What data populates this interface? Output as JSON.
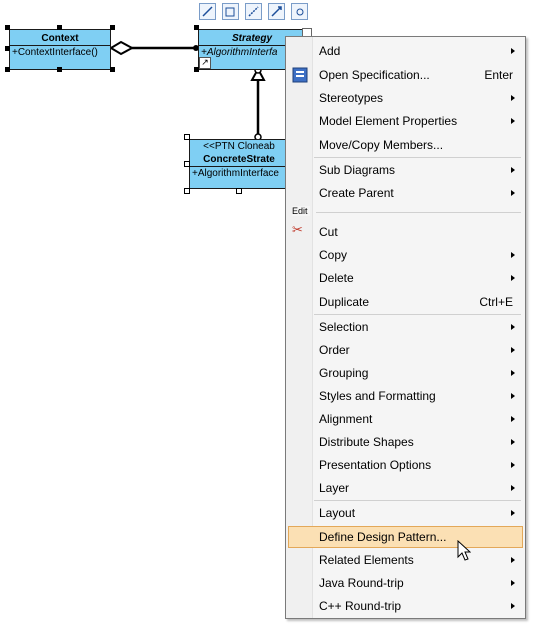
{
  "diagram": {
    "context_class": {
      "name": "Context",
      "operation": "+ContextInterface()"
    },
    "strategy_class": {
      "name": "Strategy",
      "operation": "+AlgorithmInterfa"
    },
    "concrete_class": {
      "stereotype": "<<PTN Cloneab",
      "name": "ConcreteStrate",
      "operation": "+AlgorithmInterface"
    }
  },
  "menu": {
    "edit_group_label": "Edit",
    "items": [
      {
        "label": "Add",
        "submenu": true
      },
      {
        "label": "Open Specification...",
        "shortcut": "Enter"
      },
      {
        "label": "Stereotypes",
        "submenu": true
      },
      {
        "label": "Model Element Properties",
        "submenu": true
      },
      {
        "label": "Move/Copy Members..."
      },
      {
        "label": "Sub Diagrams",
        "submenu": true
      },
      {
        "label": "Create Parent",
        "submenu": true
      },
      {
        "label": "Cut"
      },
      {
        "label": "Copy",
        "submenu": true
      },
      {
        "label": "Delete",
        "submenu": true
      },
      {
        "label": "Duplicate",
        "shortcut": "Ctrl+E"
      },
      {
        "label": "Selection",
        "submenu": true
      },
      {
        "label": "Order",
        "submenu": true
      },
      {
        "label": "Grouping",
        "submenu": true
      },
      {
        "label": "Styles and Formatting",
        "submenu": true
      },
      {
        "label": "Alignment",
        "submenu": true
      },
      {
        "label": "Distribute Shapes",
        "submenu": true
      },
      {
        "label": "Presentation Options",
        "submenu": true
      },
      {
        "label": "Layer",
        "submenu": true
      },
      {
        "label": "Layout",
        "submenu": true
      },
      {
        "label": "Define Design Pattern...",
        "highlighted": true
      },
      {
        "label": "Related Elements",
        "submenu": true
      },
      {
        "label": "Java Round-trip",
        "submenu": true
      },
      {
        "label": "C++ Round-trip",
        "submenu": true
      }
    ]
  },
  "colors": {
    "class_fill": "#7fcff3",
    "highlight": "#fbe0b4",
    "menu_bg": "#f5f5f5"
  }
}
